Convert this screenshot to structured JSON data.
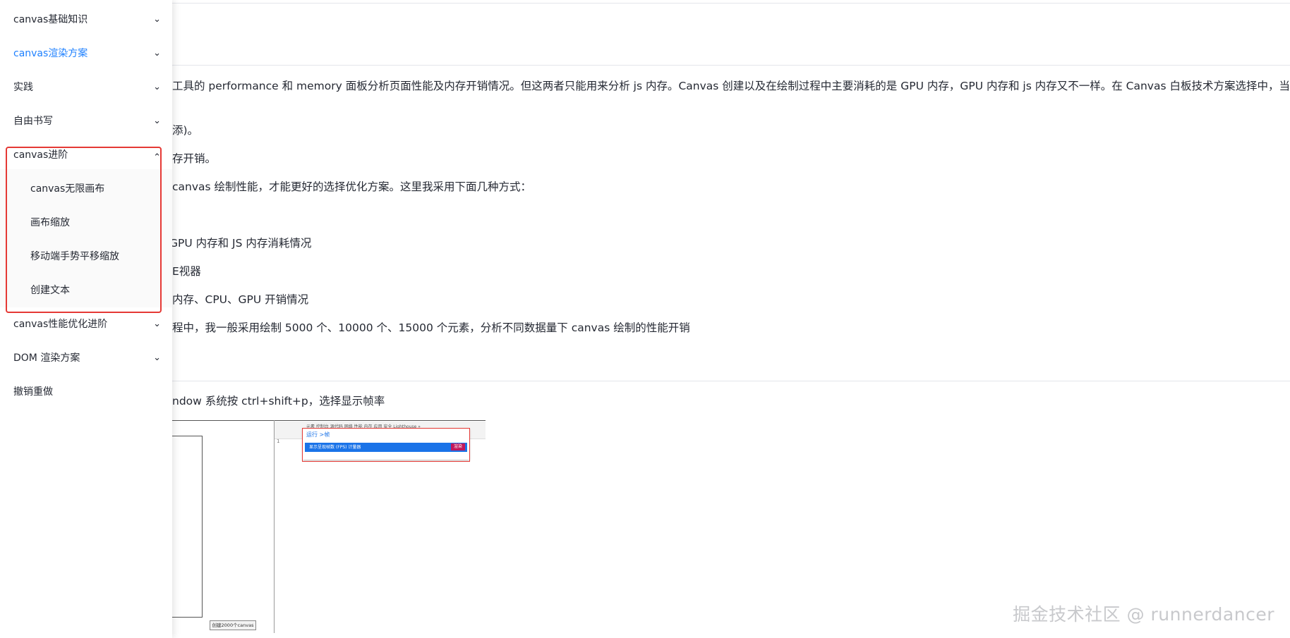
{
  "sidebar": {
    "items": [
      {
        "label": "canvas基础知识"
      },
      {
        "label": "canvas渲染方案"
      },
      {
        "label": "实践"
      },
      {
        "label": "自由书写"
      },
      {
        "label": "canvas进阶"
      },
      {
        "label": "canvas性能优化进阶"
      },
      {
        "label": "DOM 渲染方案"
      },
      {
        "label": "撤销重做"
      }
    ],
    "active_index": 1,
    "expanded_index": 4,
    "subitems": [
      {
        "label": "canvas无限画布"
      },
      {
        "label": "画布缩放"
      },
      {
        "label": "移动端手势平移缩放"
      },
      {
        "label": "创建文本"
      }
    ],
    "chevron_down": "⌄",
    "chevron_up": "⌃"
  },
  "content": {
    "paragraphs": [
      "工具的 performance 和 memory 面板分析页面性能及内存开销情况。但这两者只能用来分析 js 内存。Canvas 创建以及在绘制过程中主要消耗的是 GPU 内存，GPU 内存和 js 内存又不一样。在 Canvas 白板技术方案选择中，当绘",
      "添)。",
      "存开销。",
      "canvas 绘制性能，才能更好的选择优化方案。这里我采用下面几种方式：",
      "GPU 内存和 JS 内存消耗情况",
      "E视器",
      "内存、CPU、GPU 开销情况",
      "程中，我一般采用绘制 5000 个、10000 个、15000 个元素，分析不同数据量下 canvas 绘制的性能开销",
      "ndow 系统按 ctrl+shift+p，选择显示帧率"
    ]
  },
  "screenshot": {
    "devtools_tabs": "元素  控制台  源代码  网络  性能  内存  应用  安全  Lighthouse  »",
    "command_input": "运行 >帧",
    "command_option": "显示呈现帧数 (FPS) 计量器",
    "command_badge": "渲染",
    "button_label": "创建2000个canvas",
    "gear": "⚙",
    "line_number": "1"
  },
  "watermark": "掘金技术社区 @ runnerdancer",
  "colors": {
    "active": "#1e80ff",
    "highlight_border": "#e53935",
    "text": "#252933"
  }
}
